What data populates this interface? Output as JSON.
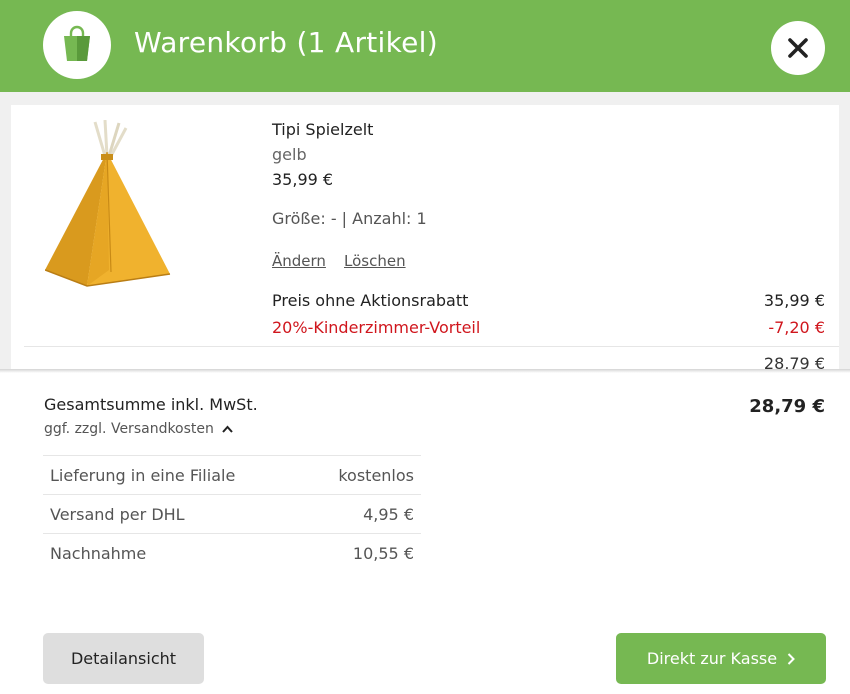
{
  "header": {
    "title": "Warenkorb (1 Artikel)",
    "brand_color": "#76b852",
    "bag_icon": "shopping-bag-icon",
    "close_icon": "close-icon"
  },
  "cart": {
    "item": {
      "name": "Tipi Spielzelt",
      "color": "gelb",
      "price": "35,99 €",
      "size_qty": "Größe: - | Anzahl: 1",
      "change_label": "Ändern",
      "delete_label": "Löschen",
      "pre_discount_label": "Preis ohne Aktionsrabatt",
      "pre_discount_value": "35,99 €",
      "promo_label": "20%-Kinderzimmer-Vorteil",
      "promo_value": "-7,20 €",
      "promo_color": "#d0161d",
      "subtotal_value": "28,79 €"
    }
  },
  "summary": {
    "total_label": "Gesamtsumme inkl. MwSt.",
    "total_value": "28,79 €",
    "shipping_toggle": "ggf. zzgl. Versandkosten",
    "shipping_options": [
      {
        "label": "Lieferung in eine Filiale",
        "value": "kostenlos"
      },
      {
        "label": "Versand per DHL",
        "value": "4,95 €"
      },
      {
        "label": "Nachnahme",
        "value": "10,55 €"
      }
    ]
  },
  "actions": {
    "detail_label": "Detailansicht",
    "checkout_label": "Direkt zur Kasse"
  }
}
